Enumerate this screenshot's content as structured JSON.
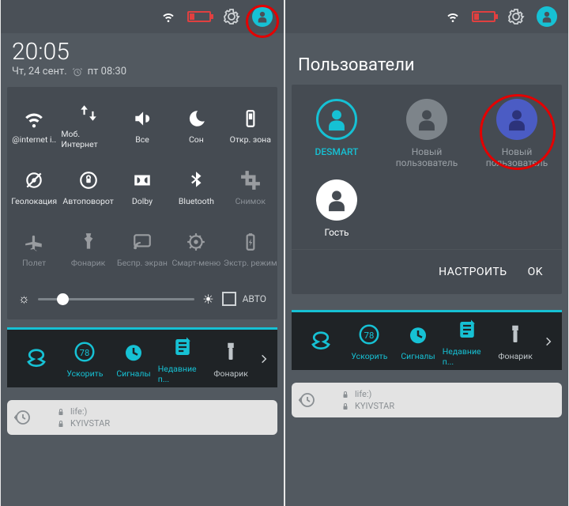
{
  "left": {
    "time": "20:05",
    "date": "Чт, 24 сент.",
    "alarm": "пт 08:30",
    "tiles": [
      {
        "label": "@internet i..",
        "icon": "wifi"
      },
      {
        "label": "Моб. Интернет",
        "icon": "updown"
      },
      {
        "label": "Все",
        "icon": "volume"
      },
      {
        "label": "Сон",
        "icon": "moon"
      },
      {
        "label": "Откр. зона",
        "icon": "hotspot"
      },
      {
        "label": "Геолокация",
        "icon": "nolocation"
      },
      {
        "label": "Автоповорот",
        "icon": "rotatelock"
      },
      {
        "label": "Dolby",
        "icon": "dolby"
      },
      {
        "label": "Bluetooth",
        "icon": "bluetooth"
      },
      {
        "label": "Снимок",
        "icon": "crop",
        "dim": true
      },
      {
        "label": "Полет",
        "icon": "plane",
        "dim": true
      },
      {
        "label": "Фонарик",
        "icon": "torch",
        "dim": true
      },
      {
        "label": "Беспр. экран",
        "icon": "cast",
        "dim": true
      },
      {
        "label": "Смарт-меню",
        "icon": "smart",
        "dim": true
      },
      {
        "label": "Экстр. режим",
        "icon": "battsave",
        "dim": true
      }
    ],
    "brightness": {
      "value_pct": 12,
      "auto_label": "АВТО"
    },
    "launcher": [
      {
        "label": "",
        "icon": "slogo",
        "accent": true
      },
      {
        "label": "Ускорить",
        "icon": "speed",
        "accent": true
      },
      {
        "label": "Сигналы",
        "icon": "alarmclock",
        "accent": true
      },
      {
        "label": "Недавние п...",
        "icon": "note",
        "accent": true
      },
      {
        "label": "Фонарик",
        "icon": "torch2",
        "accent": false
      }
    ],
    "cards": {
      "sim1": "life:)",
      "sim2": "KYIVSTAR"
    }
  },
  "right": {
    "title": "Пользователи",
    "users": [
      {
        "name": "DESMART",
        "style": "outline",
        "accent": true
      },
      {
        "name": "Новый пользователь",
        "style": "gray"
      },
      {
        "name": "Новый пользователь",
        "style": "blue",
        "highlight": true
      },
      {
        "name": "Гость",
        "style": "white"
      }
    ],
    "actions": {
      "settings": "НАСТРОИТЬ",
      "ok": "OK"
    },
    "launcher": [
      {
        "label": "",
        "icon": "slogo",
        "accent": true
      },
      {
        "label": "Ускорить",
        "icon": "speed",
        "accent": true
      },
      {
        "label": "Сигналы",
        "icon": "alarmclock",
        "accent": true
      },
      {
        "label": "Недавние п...",
        "icon": "note",
        "accent": true
      },
      {
        "label": "Фонарик",
        "icon": "torch2",
        "accent": false
      }
    ],
    "cards": {
      "sim1": "life:)",
      "sim2": "KYIVSTAR"
    }
  }
}
